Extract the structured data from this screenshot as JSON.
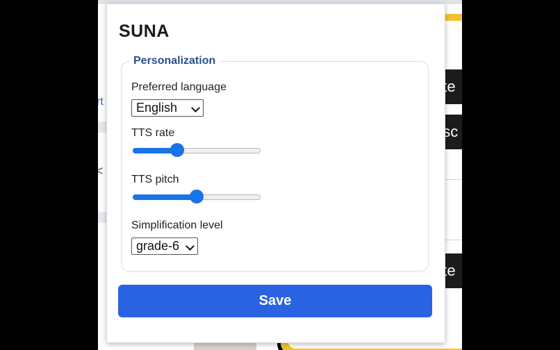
{
  "background_page": {
    "button_fragments": [
      "ate",
      "esc",
      "rite"
    ],
    "sidebar_fragments": [
      "rt",
      "<"
    ]
  },
  "popup": {
    "title": "SUNA",
    "section_legend": "Personalization",
    "preferred_language": {
      "label": "Preferred language",
      "value": "English"
    },
    "tts_rate": {
      "label": "TTS rate",
      "level": 0.35
    },
    "tts_pitch": {
      "label": "TTS pitch",
      "level": 0.5
    },
    "simplification_level": {
      "label": "Simplification level",
      "value": "grade-6"
    },
    "save_label": "Save"
  },
  "colors": {
    "accent": "#2a63e1",
    "slider": "#1a73e8",
    "legend": "#2b4f8c"
  }
}
